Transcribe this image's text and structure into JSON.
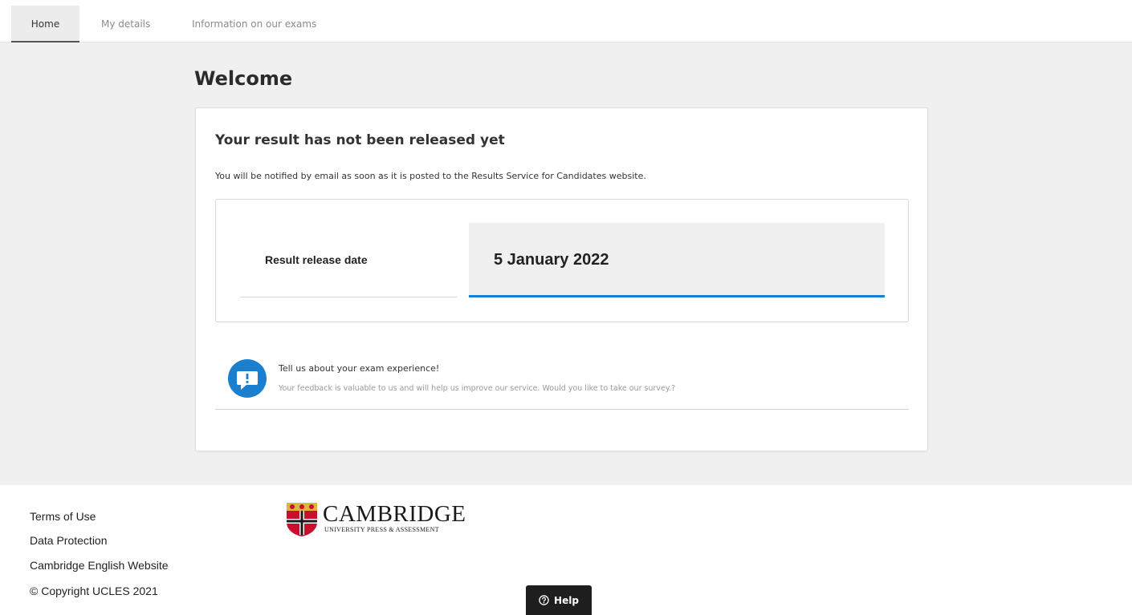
{
  "nav": {
    "tabs": [
      {
        "label": "Home"
      },
      {
        "label": "My details"
      },
      {
        "label": "Information on our exams"
      }
    ]
  },
  "main": {
    "heading": "Welcome",
    "card": {
      "title": "Your result has not been released yet",
      "subtitle": "You will be notified by email as soon as it is posted to the Results Service for Candidates website.",
      "release_label": "Result release date",
      "release_date": "5 January 2022",
      "survey": {
        "title": "Tell us about your exam experience!",
        "text": "Your feedback is valuable to us and will help us improve our service. Would you like to take our survey.?"
      }
    }
  },
  "footer": {
    "links": [
      {
        "label": "Terms of Use"
      },
      {
        "label": "Data Protection"
      },
      {
        "label": "Cambridge English Website"
      }
    ],
    "copyright": "© Copyright UCLES 2021",
    "logo": {
      "name": "CAMBRIDGE",
      "tagline": "UNIVERSITY PRESS & ASSESSMENT"
    }
  },
  "help": {
    "label": "Help"
  },
  "colors": {
    "accent": "#1a7fcf",
    "survey_icon": "#1a7fcf",
    "shield_red": "#c8102e",
    "shield_gold": "#e3b23c"
  }
}
